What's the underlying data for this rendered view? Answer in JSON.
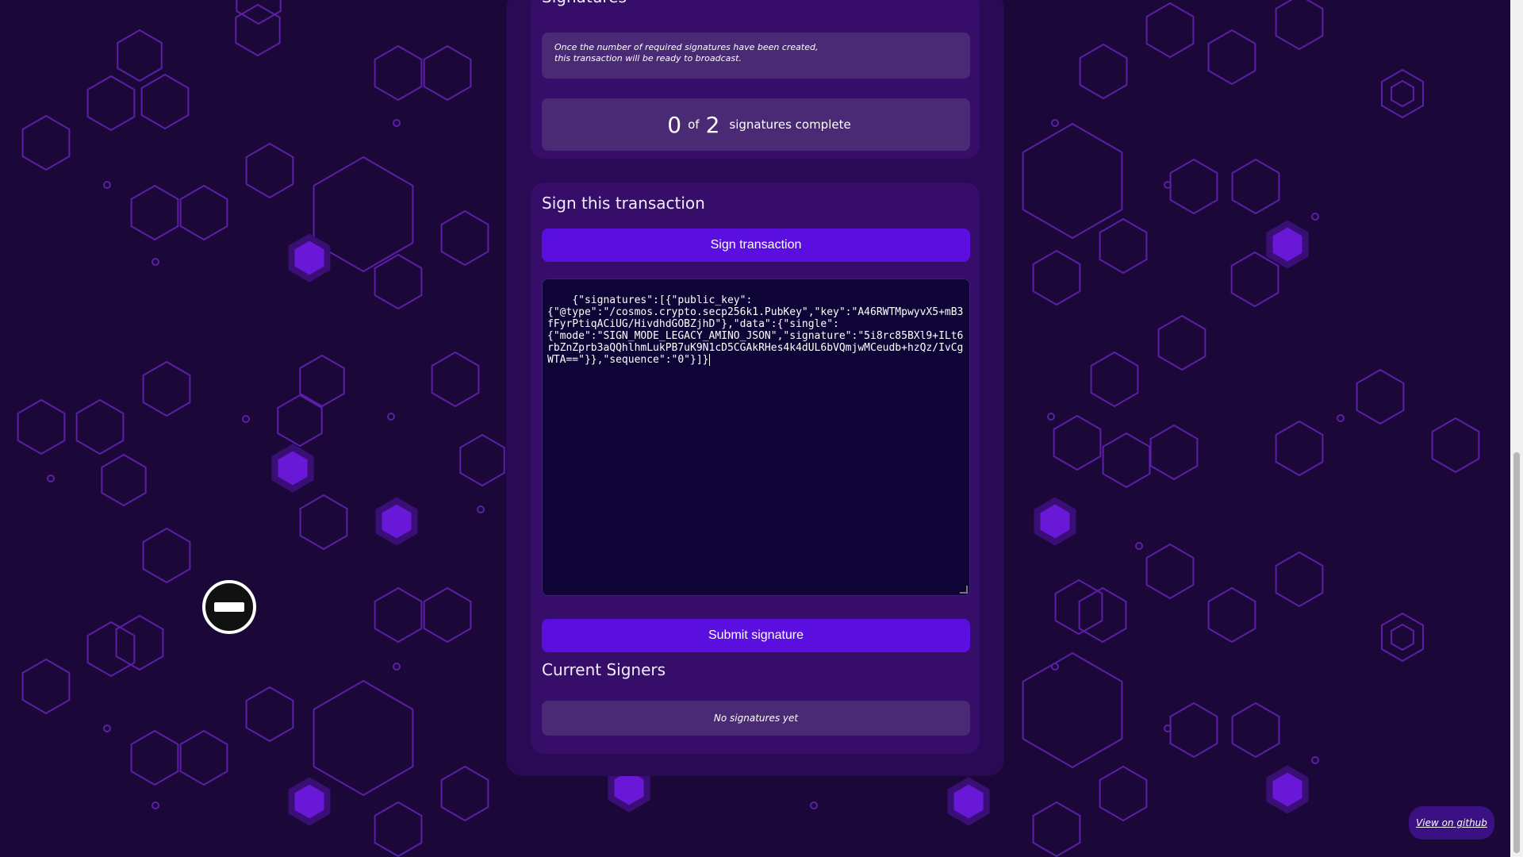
{
  "signatures_card": {
    "heading": "Signatures",
    "info_text": "Once the number of required signatures have been created, this transaction will be ready to broadcast.",
    "completed": "0",
    "of_label": "of",
    "required": "2",
    "complete_label": "signatures complete"
  },
  "sign_card": {
    "heading": "Sign this transaction",
    "sign_button_label": "Sign transaction",
    "signature_json": "{\"signatures\":[{\"public_key\":\n{\"@type\":\"/cosmos.crypto.secp256k1.PubKey\",\"key\":\"A46RWTMpwyvX5+mB3fFyrPtiqACiUG/HivdhdGOBZjhD\"},\"data\":{\"single\":\n{\"mode\":\"SIGN_MODE_LEGACY_AMINO_JSON\",\"signature\":\"5i8rc85BXl9+ILt6rbZnZprb3aQQhlhmLukPB7uK9N1cD5CGAkRHes4k4dUL6bVQmjwMCeudb+hzQz/IvCgWTA==\"}},\"sequence\":\"0\"}]}",
    "submit_button_label": "Submit signature",
    "current_signers_heading": "Current Signers",
    "no_signatures_text": "No signatures yet"
  },
  "footer": {
    "github_link": "View on github"
  },
  "colors": {
    "background": "#1b0738",
    "panel": "#2a0a55",
    "card": "#360d69",
    "accent_button": "#5a0ee0",
    "hex_fill": "#6a18d8"
  },
  "icons": {
    "cursor": "not-allowed-cursor-icon"
  }
}
